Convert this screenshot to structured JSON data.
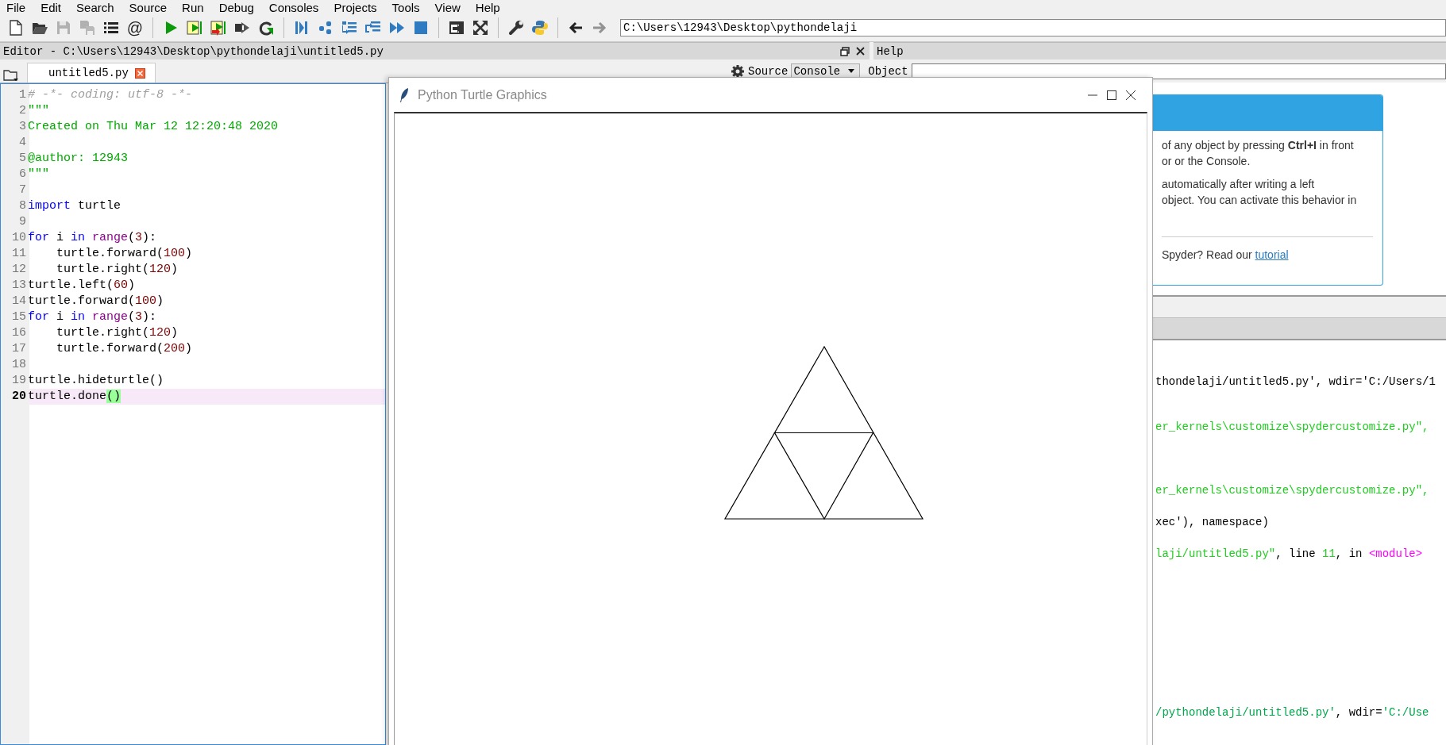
{
  "menu": [
    {
      "label": "File"
    },
    {
      "label": "Edit"
    },
    {
      "label": "Search"
    },
    {
      "label": "Source"
    },
    {
      "label": "Run"
    },
    {
      "label": "Debug"
    },
    {
      "label": "Consoles"
    },
    {
      "label": "Projects"
    },
    {
      "label": "Tools"
    },
    {
      "label": "View"
    },
    {
      "label": "Help"
    }
  ],
  "toolbar": {
    "groups": [
      [
        {
          "kind": "new",
          "disabled": false
        },
        {
          "kind": "open",
          "disabled": false
        },
        {
          "kind": "save",
          "disabled": true
        },
        {
          "kind": "saveall",
          "disabled": true
        },
        {
          "kind": "list",
          "disabled": false
        },
        {
          "kind": "glyph",
          "glyph": "@",
          "disabled": false
        }
      ],
      [
        {
          "kind": "run",
          "disabled": false
        },
        {
          "kind": "runcell",
          "disabled": false
        },
        {
          "kind": "runcelladvance",
          "disabled": false
        },
        {
          "kind": "runselection",
          "disabled": false
        },
        {
          "kind": "rerun",
          "disabled": false
        }
      ],
      [
        {
          "kind": "debug",
          "disabled": false
        },
        {
          "kind": "step",
          "disabled": false
        },
        {
          "kind": "stepinto",
          "disabled": false
        },
        {
          "kind": "stepreturn",
          "disabled": false
        },
        {
          "kind": "continue",
          "disabled": false
        },
        {
          "kind": "stop",
          "disabled": false
        }
      ],
      [
        {
          "kind": "maximize",
          "disabled": false
        },
        {
          "kind": "fullscreen",
          "disabled": false
        }
      ],
      [
        {
          "kind": "wrench",
          "disabled": false
        },
        {
          "kind": "python",
          "disabled": false
        }
      ],
      [
        {
          "kind": "back",
          "disabled": false
        },
        {
          "kind": "forward",
          "disabled": true
        }
      ]
    ],
    "path": "C:\\Users\\12943\\Desktop\\pythondelaji"
  },
  "editor": {
    "title": "Editor - C:\\Users\\12943\\Desktop\\pythondelaji\\untitled5.py",
    "tabs": [
      {
        "label": "untitled5.py",
        "selected": true
      }
    ],
    "lines": [
      {
        "number": "1",
        "current": false,
        "tokens": [
          {
            "text": "# -*- coding: utf-8 -*-",
            "kind": "comment"
          }
        ]
      },
      {
        "number": "2",
        "current": false,
        "tokens": [
          {
            "text": "\"\"\"",
            "kind": "string"
          }
        ]
      },
      {
        "number": "3",
        "current": false,
        "tokens": [
          {
            "text": "Created on Thu Mar 12 12:20:48 2020",
            "kind": "string"
          }
        ]
      },
      {
        "number": "4",
        "current": false
      },
      {
        "number": "5",
        "current": false,
        "tokens": [
          {
            "text": "@author: 12943",
            "kind": "string"
          }
        ]
      },
      {
        "number": "6",
        "current": false,
        "tokens": [
          {
            "text": "\"\"\"",
            "kind": "string"
          }
        ]
      },
      {
        "number": "7",
        "current": false
      },
      {
        "number": "8",
        "current": false,
        "tokens": [
          {
            "text": "import",
            "kind": "keyword"
          },
          {
            "text": " turtle",
            "kind": "plain"
          }
        ]
      },
      {
        "number": "9",
        "current": false
      },
      {
        "number": "10",
        "current": false,
        "tokens": [
          {
            "text": "for",
            "kind": "keyword"
          },
          {
            "text": " i ",
            "kind": "plain"
          },
          {
            "text": "in ",
            "kind": "keyword"
          },
          {
            "text": "range",
            "kind": "builtin"
          },
          {
            "text": "(",
            "kind": "plain"
          },
          {
            "text": "3",
            "kind": "number"
          },
          {
            "text": "):",
            "kind": "plain"
          }
        ]
      },
      {
        "number": "11",
        "current": false,
        "tokens": [
          {
            "text": "    turtle.forward(",
            "kind": "plain"
          },
          {
            "text": "100",
            "kind": "number"
          },
          {
            "text": ")",
            "kind": "plain"
          }
        ]
      },
      {
        "number": "12",
        "current": false,
        "tokens": [
          {
            "text": "    turtle.right(",
            "kind": "plain"
          },
          {
            "text": "120",
            "kind": "number"
          },
          {
            "text": ")",
            "kind": "plain"
          }
        ]
      },
      {
        "number": "13",
        "current": false,
        "tokens": [
          {
            "text": "turtle.left(",
            "kind": "plain"
          },
          {
            "text": "60",
            "kind": "number"
          },
          {
            "text": ")",
            "kind": "plain"
          }
        ]
      },
      {
        "number": "14",
        "current": false,
        "tokens": [
          {
            "text": "turtle.forward(",
            "kind": "plain"
          },
          {
            "text": "100",
            "kind": "number"
          },
          {
            "text": ")",
            "kind": "plain"
          }
        ]
      },
      {
        "number": "15",
        "current": false,
        "tokens": [
          {
            "text": "for",
            "kind": "keyword"
          },
          {
            "text": " i ",
            "kind": "plain"
          },
          {
            "text": "in ",
            "kind": "keyword"
          },
          {
            "text": "range",
            "kind": "builtin"
          },
          {
            "text": "(",
            "kind": "plain"
          },
          {
            "text": "3",
            "kind": "number"
          },
          {
            "text": "):",
            "kind": "plain"
          }
        ]
      },
      {
        "number": "16",
        "current": false,
        "tokens": [
          {
            "text": "    turtle.right(",
            "kind": "plain"
          },
          {
            "text": "120",
            "kind": "number"
          },
          {
            "text": ")",
            "kind": "plain"
          }
        ]
      },
      {
        "number": "17",
        "current": false,
        "tokens": [
          {
            "text": "    turtle.forward(",
            "kind": "plain"
          },
          {
            "text": "200",
            "kind": "number"
          },
          {
            "text": ")",
            "kind": "plain"
          }
        ]
      },
      {
        "number": "18",
        "current": false
      },
      {
        "number": "19",
        "current": false,
        "tokens": [
          {
            "text": "turtle.hideturtle()",
            "kind": "plain"
          }
        ]
      },
      {
        "number": "20",
        "current": true,
        "tokens": [
          {
            "text": "turtle.done",
            "kind": "plain"
          },
          {
            "text": "()",
            "kind": "match"
          }
        ]
      }
    ]
  },
  "help": {
    "title": "Help",
    "source_label": "Source",
    "source_value": "Console",
    "object_label": "Object",
    "card_lines": [
      "of any object by pressing **Ctrl+I** in front",
      "or or the Console.",
      "automatically after writing a left",
      "object. You can activate this behavior in"
    ],
    "footer": "Spyder? Read our",
    "link": "tutorial"
  },
  "console": {
    "lines": [
      [
        {
          "text": "thondelaji/untitled5.py', wdir='C:/Users/1",
          "kind": "text"
        }
      ],
      [
        {
          "text": "er_kernels\\customize\\spydercustomize.py\",",
          "kind": "path"
        }
      ],
      [
        {
          "text": "er_kernels\\customize\\spydercustomize.py\",",
          "kind": "path"
        }
      ],
      [
        {
          "text": "xec'), namespace)",
          "kind": "text"
        }
      ],
      [
        {
          "text": "laji/untitled5.py\"",
          "kind": "path"
        },
        {
          "text": ", line ",
          "kind": "text"
        },
        {
          "text": "11",
          "kind": "path"
        },
        {
          "text": ", in ",
          "kind": "text"
        },
        {
          "text": "<module>",
          "kind": "module"
        }
      ],
      [
        {
          "text": "/pythondelaji/untitled5.py'",
          "kind": "string"
        },
        {
          "text": ", wdir=",
          "kind": "text"
        },
        {
          "text": "'C:/Use",
          "kind": "string"
        }
      ]
    ]
  },
  "turtle_window": {
    "title": "Python Turtle Graphics"
  }
}
